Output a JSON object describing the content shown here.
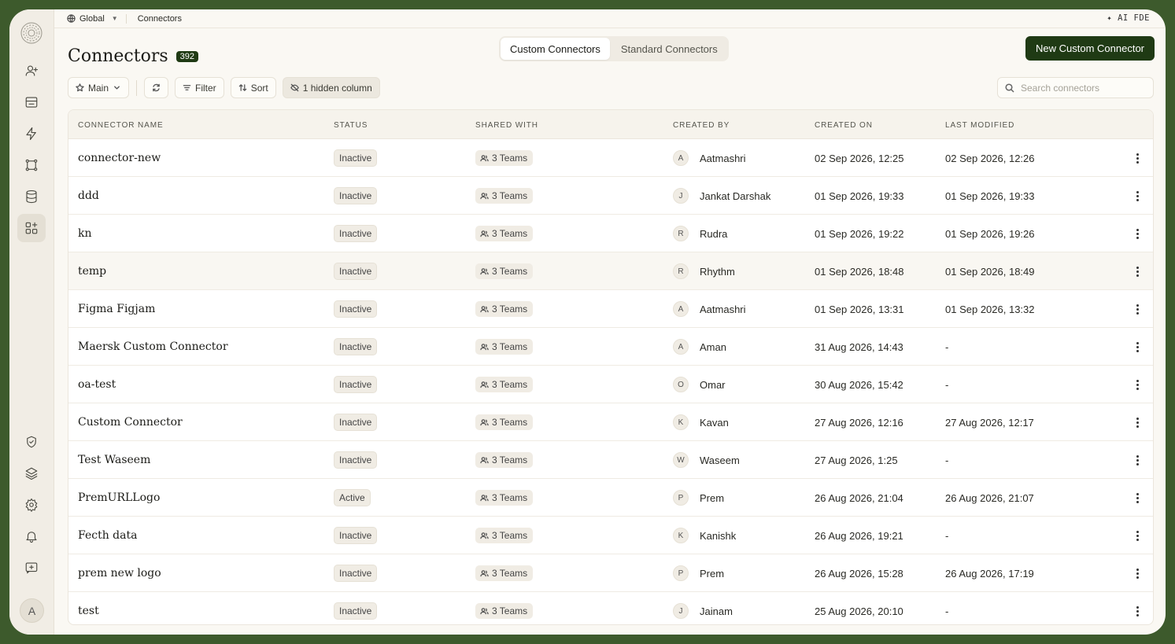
{
  "sidebar": {
    "avatar_initial": "A",
    "icons": [
      "user-plus-icon",
      "inbox-icon",
      "lightning-icon",
      "workflow-icon",
      "database-icon",
      "apps-add-icon",
      "shield-check-icon",
      "layers-icon",
      "gear-icon",
      "bell-icon",
      "feedback-icon"
    ]
  },
  "topbar": {
    "scope": "Global",
    "breadcrumb": "Connectors",
    "ai_label": "AI FDE"
  },
  "header": {
    "title": "Connectors",
    "count": "392",
    "tabs": [
      {
        "label": "Custom Connectors",
        "active": true
      },
      {
        "label": "Standard Connectors",
        "active": false
      }
    ],
    "new_button": "New Custom Connector"
  },
  "toolbar": {
    "view": "Main",
    "filter": "Filter",
    "sort": "Sort",
    "hidden_columns": "1 hidden column",
    "search_placeholder": "Search connectors"
  },
  "colors": {
    "accent": "#1f3a14",
    "frame_bg": "#3d5a2c"
  },
  "table": {
    "columns": [
      "CONNECTOR NAME",
      "STATUS",
      "SHARED WITH",
      "CREATED BY",
      "CREATED ON",
      "LAST MODIFIED"
    ],
    "rows": [
      {
        "name": "connector-new",
        "status": "Inactive",
        "shared": "3 Teams",
        "initial": "A",
        "creator": "Aatmashri",
        "created_on": "02 Sep 2026, 12:25",
        "modified": "02 Sep 2026, 12:26"
      },
      {
        "name": "ddd",
        "status": "Inactive",
        "shared": "3 Teams",
        "initial": "J",
        "creator": "Jankat Darshak",
        "created_on": "01 Sep 2026, 19:33",
        "modified": "01 Sep 2026, 19:33"
      },
      {
        "name": "kn",
        "status": "Inactive",
        "shared": "3 Teams",
        "initial": "R",
        "creator": "Rudra",
        "created_on": "01 Sep 2026, 19:22",
        "modified": "01 Sep 2026, 19:26"
      },
      {
        "name": "temp",
        "status": "Inactive",
        "shared": "3 Teams",
        "initial": "R",
        "creator": "Rhythm",
        "created_on": "01 Sep 2026, 18:48",
        "modified": "01 Sep 2026, 18:49"
      },
      {
        "name": "Figma Figjam",
        "status": "Inactive",
        "shared": "3 Teams",
        "initial": "A",
        "creator": "Aatmashri",
        "created_on": "01 Sep 2026, 13:31",
        "modified": "01 Sep 2026, 13:32"
      },
      {
        "name": "Maersk Custom Connector",
        "status": "Inactive",
        "shared": "3 Teams",
        "initial": "A",
        "creator": "Aman",
        "created_on": "31 Aug 2026, 14:43",
        "modified": "-"
      },
      {
        "name": "oa-test",
        "status": "Inactive",
        "shared": "3 Teams",
        "initial": "O",
        "creator": "Omar",
        "created_on": "30 Aug 2026, 15:42",
        "modified": "-"
      },
      {
        "name": "Custom Connector",
        "status": "Inactive",
        "shared": "3 Teams",
        "initial": "K",
        "creator": "Kavan",
        "created_on": "27 Aug 2026, 12:16",
        "modified": "27 Aug 2026, 12:17"
      },
      {
        "name": "Test Waseem",
        "status": "Inactive",
        "shared": "3 Teams",
        "initial": "W",
        "creator": "Waseem",
        "created_on": "27 Aug 2026, 1:25",
        "modified": "-"
      },
      {
        "name": "PremURLLogo",
        "status": "Active",
        "shared": "3 Teams",
        "initial": "P",
        "creator": "Prem",
        "created_on": "26 Aug 2026, 21:04",
        "modified": "26 Aug 2026, 21:07"
      },
      {
        "name": "Fecth data",
        "status": "Inactive",
        "shared": "3 Teams",
        "initial": "K",
        "creator": "Kanishk",
        "created_on": "26 Aug 2026, 19:21",
        "modified": "-"
      },
      {
        "name": "prem new logo",
        "status": "Inactive",
        "shared": "3 Teams",
        "initial": "P",
        "creator": "Prem",
        "created_on": "26 Aug 2026, 15:28",
        "modified": "26 Aug 2026, 17:19"
      },
      {
        "name": "test",
        "status": "Inactive",
        "shared": "3 Teams",
        "initial": "J",
        "creator": "Jainam",
        "created_on": "25 Aug 2026, 20:10",
        "modified": "-"
      }
    ]
  }
}
